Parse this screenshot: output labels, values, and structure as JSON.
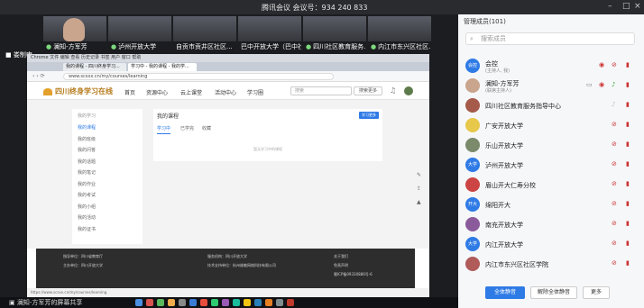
{
  "window": {
    "title": "腾讯会议 会议号：934 240 833"
  },
  "thumbs": [
    {
      "label": "澜知-方军芳"
    },
    {
      "label": "泸州开放大学"
    },
    {
      "label": "自贡市贡井区社区..."
    },
    {
      "label": "巴中开放大学（巴中社..."
    },
    {
      "label": "四川社区教育服务..."
    },
    {
      "label": "内江市东兴区社区..."
    }
  ],
  "me_label": "娄制申",
  "browser": {
    "menubar": "Chrome 文件 编辑 查看 历史记录 书签 用户 窗口 帮助",
    "tab1": "我的课程 - 四川终身学习...",
    "tab2": "学习中 - 我的课程 - 我的学...",
    "url": "www.scsxx.cn/my/courses/learning"
  },
  "site": {
    "logo": "四川终身学习在线",
    "nav": [
      "首页",
      "资源中心",
      "云上课堂",
      "活动中心",
      "学习圈"
    ],
    "search_placeholder": "搜索",
    "search_button": "搜索更多"
  },
  "sidebar": {
    "heading": "我的学习",
    "items": [
      "我的课程",
      "我的班级",
      "我的问答",
      "我的话题",
      "我的笔记",
      "我的作业",
      "我的考试",
      "我的小组",
      "我的活动",
      "我的证书"
    ]
  },
  "main": {
    "title": "我的课程",
    "button": "学习更多",
    "tabs": [
      "学习中",
      "已学完",
      "收藏"
    ],
    "empty": "暂无学习中的课程"
  },
  "footer": {
    "sponsor": "指导单位：四川省教育厅",
    "host": "主办单位：四川开放大学",
    "operator": "服务机构：四川开放大学",
    "tech": "技术支持单位：杭州维敏网络科技有限公司",
    "about": "关于我们",
    "disclaimer": "免责声明",
    "icp": "蜀ICP备09330886号-6"
  },
  "statusbar": "https://www.scsxx.cn/my/courses/learning",
  "taskbar": {
    "label": "澜知-方军芳的屏幕共享"
  },
  "panel": {
    "title": "管理成员(101)",
    "search_placeholder": "搜索成员",
    "members": [
      {
        "name": "会控",
        "sub": "(主持人, 我)",
        "avatar": "会控",
        "color": "#2f7be6"
      },
      {
        "name": "澜知-方军芳",
        "sub": "(联席主持人)",
        "avatar": "",
        "color": "#c9a58e"
      },
      {
        "name": "四川社区教育服务指导中心",
        "sub": "",
        "avatar": "",
        "color": "#a55a4a"
      },
      {
        "name": "广安开放大学",
        "sub": "",
        "avatar": "",
        "color": "#e7c84a"
      },
      {
        "name": "乐山开放大学",
        "sub": "",
        "avatar": "",
        "color": "#7a8a6a"
      },
      {
        "name": "泸州开放大学",
        "sub": "",
        "avatar": "大学",
        "color": "#2f7be6"
      },
      {
        "name": "眉山开大仁寿分校",
        "sub": "",
        "avatar": "",
        "color": "#c44"
      },
      {
        "name": "绵阳开大",
        "sub": "",
        "avatar": "开大",
        "color": "#2f7be6"
      },
      {
        "name": "南充开放大学",
        "sub": "",
        "avatar": "",
        "color": "#8a5a9a"
      },
      {
        "name": "内江开放大学",
        "sub": "",
        "avatar": "大学",
        "color": "#2f7be6"
      },
      {
        "name": "内江市东兴区社区学院",
        "sub": "",
        "avatar": "",
        "color": "#b05a5a"
      }
    ],
    "buttons": [
      "全体静音",
      "解除全体静音",
      "更多"
    ]
  }
}
